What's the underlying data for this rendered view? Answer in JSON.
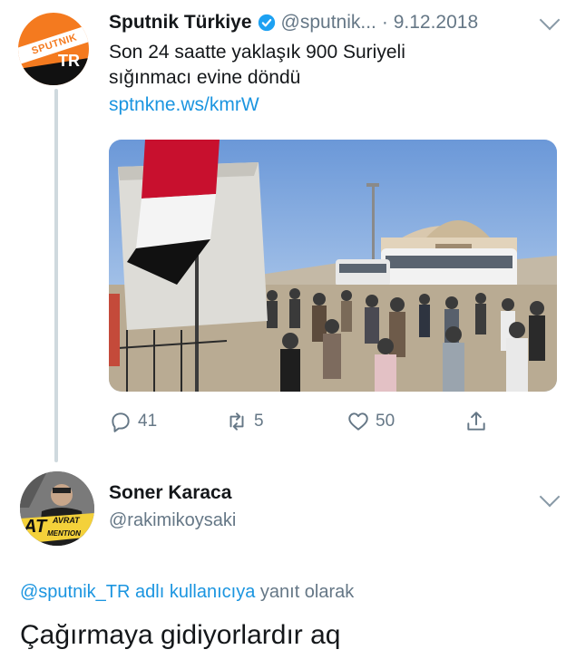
{
  "tweet": {
    "author_name": "Sputnik Türkiye",
    "author_handle": "@sputnik...",
    "date": "· 9.12.2018",
    "text_line1": "Son 24 saatte yaklaşık 900 Suriyeli",
    "text_line2": "sığınmacı evine döndü",
    "link": "sptnkne.ws/kmrW",
    "avatar_text": "SPUTNIK",
    "avatar_badge": "TR",
    "replies": "41",
    "retweets": "5",
    "likes": "50"
  },
  "reply": {
    "author_name": "Soner Karaca",
    "author_handle": "@rakimikoysaki",
    "avatar_text_1": "AT",
    "avatar_text_2": "AVRAT",
    "avatar_text_3": "MENTION",
    "replying_to_handle": "@sputnik_TR",
    "replying_to_suffix": "adlı kullanıcıya",
    "replying_to_suffix2": "yanıt olarak",
    "text": "Çağırmaya gidiyorlardır aq"
  },
  "colors": {
    "link_blue": "#1b95e0",
    "secondary_gray": "#657786",
    "brand_orange": "#f47a1f"
  }
}
